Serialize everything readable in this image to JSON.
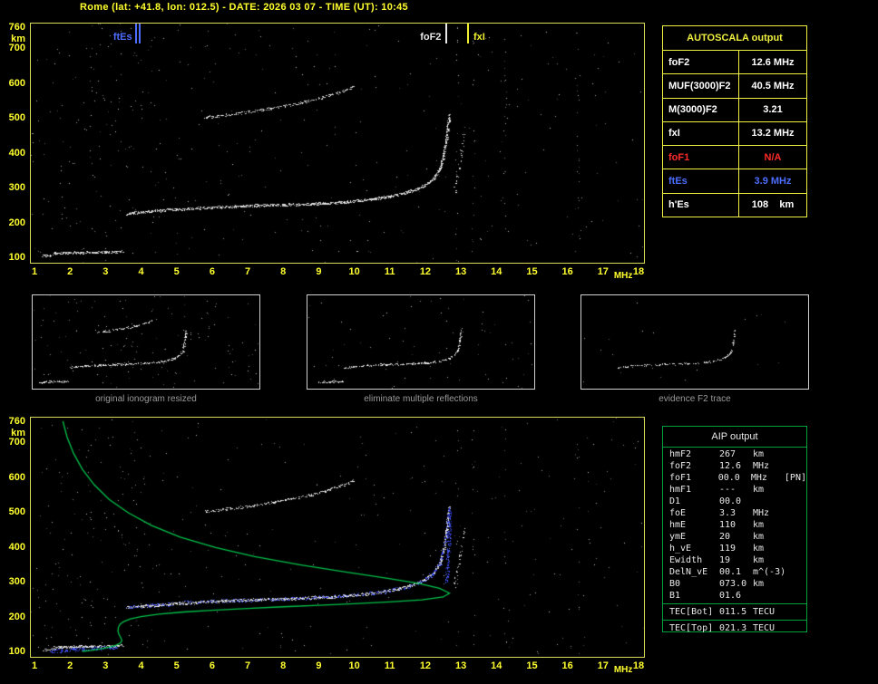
{
  "window": {
    "title": "Rome (lat: +41.8, lon: 012.5) - DATE: 2026 03 07 - TIME (UT): 10:45"
  },
  "units": {
    "freq": "MHz",
    "height": "km"
  },
  "axes": {
    "x_ticks": [
      "1",
      "2",
      "3",
      "4",
      "5",
      "6",
      "7",
      "8",
      "9",
      "10",
      "11",
      "12",
      "13",
      "14",
      "15",
      "16",
      "17",
      "18"
    ],
    "y_ticks": [
      "760",
      "700",
      "600",
      "500",
      "400",
      "300",
      "200",
      "100"
    ]
  },
  "markers": [
    {
      "id": "ftEs",
      "label": "ftEs",
      "freq": 3.9,
      "color": "#4d6dff",
      "label_side": "left",
      "double": true
    },
    {
      "id": "foF2",
      "label": "foF2",
      "freq": 12.6,
      "color": "#e8e8e8",
      "label_side": "left",
      "double": false
    },
    {
      "id": "fxI",
      "label": "fxI",
      "freq": 13.2,
      "color": "#f0f030",
      "label_side": "right",
      "double": false
    }
  ],
  "autoscala_table": {
    "title": "AUTOSCALA output",
    "rows": [
      {
        "label": "foF2",
        "value": "12.6 MHz",
        "color": "#ffffff"
      },
      {
        "label": "MUF(3000)F2",
        "value": "40.5 MHz",
        "color": "#ffffff"
      },
      {
        "label": "M(3000)F2",
        "value": "3.21",
        "color": "#ffffff"
      },
      {
        "label": "fxI",
        "value": "13.2 MHz",
        "color": "#ffffff"
      },
      {
        "label": "foF1",
        "value": "N/A",
        "color": "#ff2a2a"
      },
      {
        "label": "ftEs",
        "value": "3.9 MHz",
        "color": "#4d6dff"
      },
      {
        "label": "h'Es",
        "value": "108    km",
        "color": "#ffffff"
      }
    ]
  },
  "thumbnails": [
    {
      "caption": "original ionogram resized"
    },
    {
      "caption": "eliminate multiple reflections"
    },
    {
      "caption": "evidence F2 trace"
    }
  ],
  "aip_panel": {
    "title": "AIP output",
    "rows": [
      {
        "label": "hmF2",
        "value": "267",
        "unit": "km",
        "extra": ""
      },
      {
        "label": "foF2",
        "value": "12.6",
        "unit": "MHz",
        "extra": ""
      },
      {
        "label": "foF1",
        "value": "00.0",
        "unit": "MHz",
        "extra": "[PN]"
      },
      {
        "label": "hmF1",
        "value": "---",
        "unit": "km",
        "extra": ""
      },
      {
        "label": "D1",
        "value": "00.0",
        "unit": "",
        "extra": ""
      },
      {
        "label": "foE",
        "value": "3.3",
        "unit": "MHz",
        "extra": ""
      },
      {
        "label": "hmE",
        "value": "110",
        "unit": "km",
        "extra": ""
      },
      {
        "label": "ymE",
        "value": "20",
        "unit": "km",
        "extra": ""
      },
      {
        "label": "h_vE",
        "value": "119",
        "unit": "km",
        "extra": ""
      },
      {
        "label": "Ewidth",
        "value": "19",
        "unit": "km",
        "extra": ""
      },
      {
        "label": "DelN_vE",
        "value": "00.1",
        "unit": "m^(-3)",
        "extra": ""
      },
      {
        "label": "B0",
        "value": "073.0",
        "unit": "km",
        "extra": ""
      },
      {
        "label": "B1",
        "value": "01.6",
        "unit": "",
        "extra": ""
      }
    ],
    "tec_rows": [
      {
        "label": "TEC[Bot]",
        "value": "011.5",
        "unit": "TECU"
      },
      {
        "label": "TEC[Top]",
        "value": "021.3",
        "unit": "TECU"
      }
    ]
  },
  "chart_data": {
    "type": "scatter",
    "title": "ionogram",
    "x_axis": {
      "label": "MHz",
      "range": [
        1,
        18
      ]
    },
    "y_axis": {
      "label": "km",
      "range": [
        100,
        760
      ]
    },
    "traces": {
      "es_layer": [
        [
          1.55,
          112
        ],
        [
          2.0,
          114
        ],
        [
          2.55,
          115
        ],
        [
          3.05,
          116
        ],
        [
          3.45,
          117
        ]
      ],
      "es_blob": [
        [
          1.22,
          105
        ],
        [
          1.5,
          107
        ]
      ],
      "f2_ordinary": [
        [
          3.6,
          226
        ],
        [
          4.2,
          232
        ],
        [
          5.0,
          238
        ],
        [
          6.0,
          244
        ],
        [
          7.0,
          248
        ],
        [
          8.0,
          251
        ],
        [
          9.0,
          255
        ],
        [
          9.8,
          260
        ],
        [
          10.5,
          267
        ],
        [
          11.0,
          275
        ],
        [
          11.5,
          287
        ],
        [
          11.9,
          302
        ],
        [
          12.2,
          323
        ],
        [
          12.4,
          353
        ],
        [
          12.5,
          391
        ],
        [
          12.58,
          438
        ],
        [
          12.63,
          488
        ],
        [
          12.66,
          512
        ]
      ],
      "f2_second_hop": [
        [
          5.8,
          502
        ],
        [
          6.4,
          509
        ],
        [
          7.0,
          517
        ],
        [
          7.6,
          527
        ],
        [
          8.2,
          538
        ],
        [
          8.8,
          551
        ],
        [
          9.3,
          565
        ],
        [
          9.7,
          579
        ],
        [
          9.95,
          591
        ]
      ],
      "x_mode": [
        [
          12.82,
          290
        ],
        [
          12.92,
          350
        ],
        [
          13.02,
          410
        ],
        [
          13.1,
          455
        ]
      ],
      "blue_overlay_cusp": [
        [
          12.6,
          300
        ],
        [
          12.64,
          380
        ],
        [
          12.67,
          450
        ],
        [
          12.69,
          505
        ]
      ],
      "blue_es": [
        [
          1.45,
          101
        ],
        [
          1.9,
          104
        ],
        [
          2.4,
          107
        ],
        [
          2.9,
          110
        ],
        [
          3.3,
          113
        ]
      ]
    },
    "green_profile": [
      [
        1.8,
        760
      ],
      [
        1.92,
        714
      ],
      [
        2.1,
        668
      ],
      [
        2.35,
        622
      ],
      [
        2.68,
        578
      ],
      [
        3.1,
        536
      ],
      [
        3.65,
        497
      ],
      [
        4.3,
        461
      ],
      [
        5.1,
        428
      ],
      [
        6.1,
        398
      ],
      [
        7.2,
        372
      ],
      [
        8.5,
        348
      ],
      [
        9.8,
        327
      ],
      [
        10.9,
        310
      ],
      [
        11.8,
        295
      ],
      [
        12.4,
        281
      ],
      [
        12.68,
        267
      ],
      [
        12.5,
        256
      ],
      [
        11.9,
        248
      ],
      [
        11.0,
        242
      ],
      [
        10.0,
        237
      ],
      [
        9.0,
        232
      ],
      [
        8.0,
        228
      ],
      [
        7.0,
        223
      ],
      [
        6.0,
        218
      ],
      [
        5.2,
        213
      ],
      [
        4.5,
        207
      ],
      [
        4.0,
        200
      ],
      [
        3.7,
        193
      ],
      [
        3.5,
        185
      ],
      [
        3.4,
        177
      ],
      [
        3.36,
        168
      ],
      [
        3.35,
        158
      ],
      [
        3.38,
        148
      ],
      [
        3.43,
        139
      ],
      [
        3.46,
        131
      ],
      [
        3.42,
        124
      ],
      [
        3.3,
        118
      ],
      [
        3.1,
        112
      ],
      [
        2.85,
        107
      ],
      [
        2.6,
        103
      ],
      [
        2.35,
        100
      ]
    ]
  },
  "render": {
    "frame_color": "#d9d955",
    "axis_color": "#ffff2e",
    "profile_color": "#00c14a",
    "noise_top": 330,
    "noise_bottom": 300,
    "left_extra": 90,
    "streaks": [
      2.6,
      12.9,
      13.35,
      14.25,
      16.3
    ],
    "thumb_noise": [
      150,
      70,
      20
    ],
    "seeds": {
      "top": 9,
      "bottom": 17,
      "t1": 3,
      "t2": 4,
      "t3": 5
    }
  }
}
